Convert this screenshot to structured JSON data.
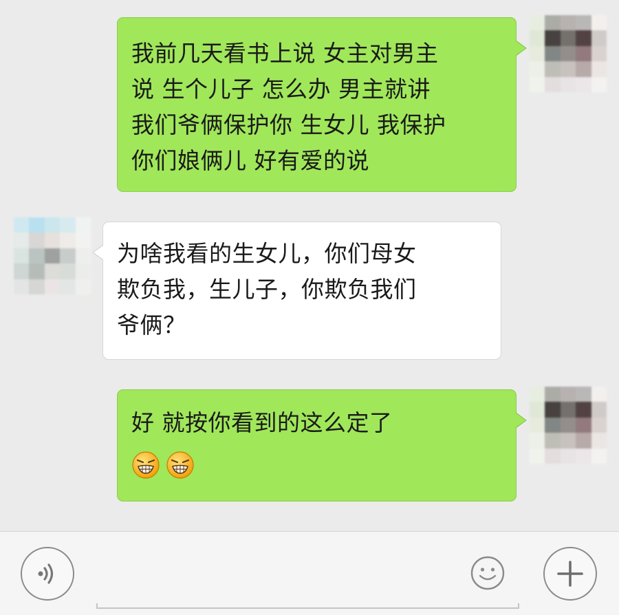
{
  "messages": [
    {
      "side": "sent",
      "text": "我前几天看书上说 女主对男主\n说 生个儿子 怎么办 男主就讲\n我们爷俩保护你 生女儿 我保护\n你们娘俩儿 好有爱的说"
    },
    {
      "side": "received",
      "text": "为啥我看的生女儿，你们母女\n欺负我，生儿子，你欺负我们\n爷俩？"
    },
    {
      "side": "sent",
      "text": "好 就按你看到的这么定了",
      "emojis": [
        "grinning-face-emoji",
        "grinning-face-emoji"
      ]
    }
  ],
  "input_bar": {
    "voice_icon": "voice-wave-icon",
    "input_value": "",
    "emoji_icon": "smiley-icon",
    "plus_icon": "plus-icon"
  },
  "colors": {
    "background": "#ebebeb",
    "sent_bubble": "#a0e75a",
    "received_bubble": "#ffffff",
    "input_bar": "#f5f5f5"
  }
}
